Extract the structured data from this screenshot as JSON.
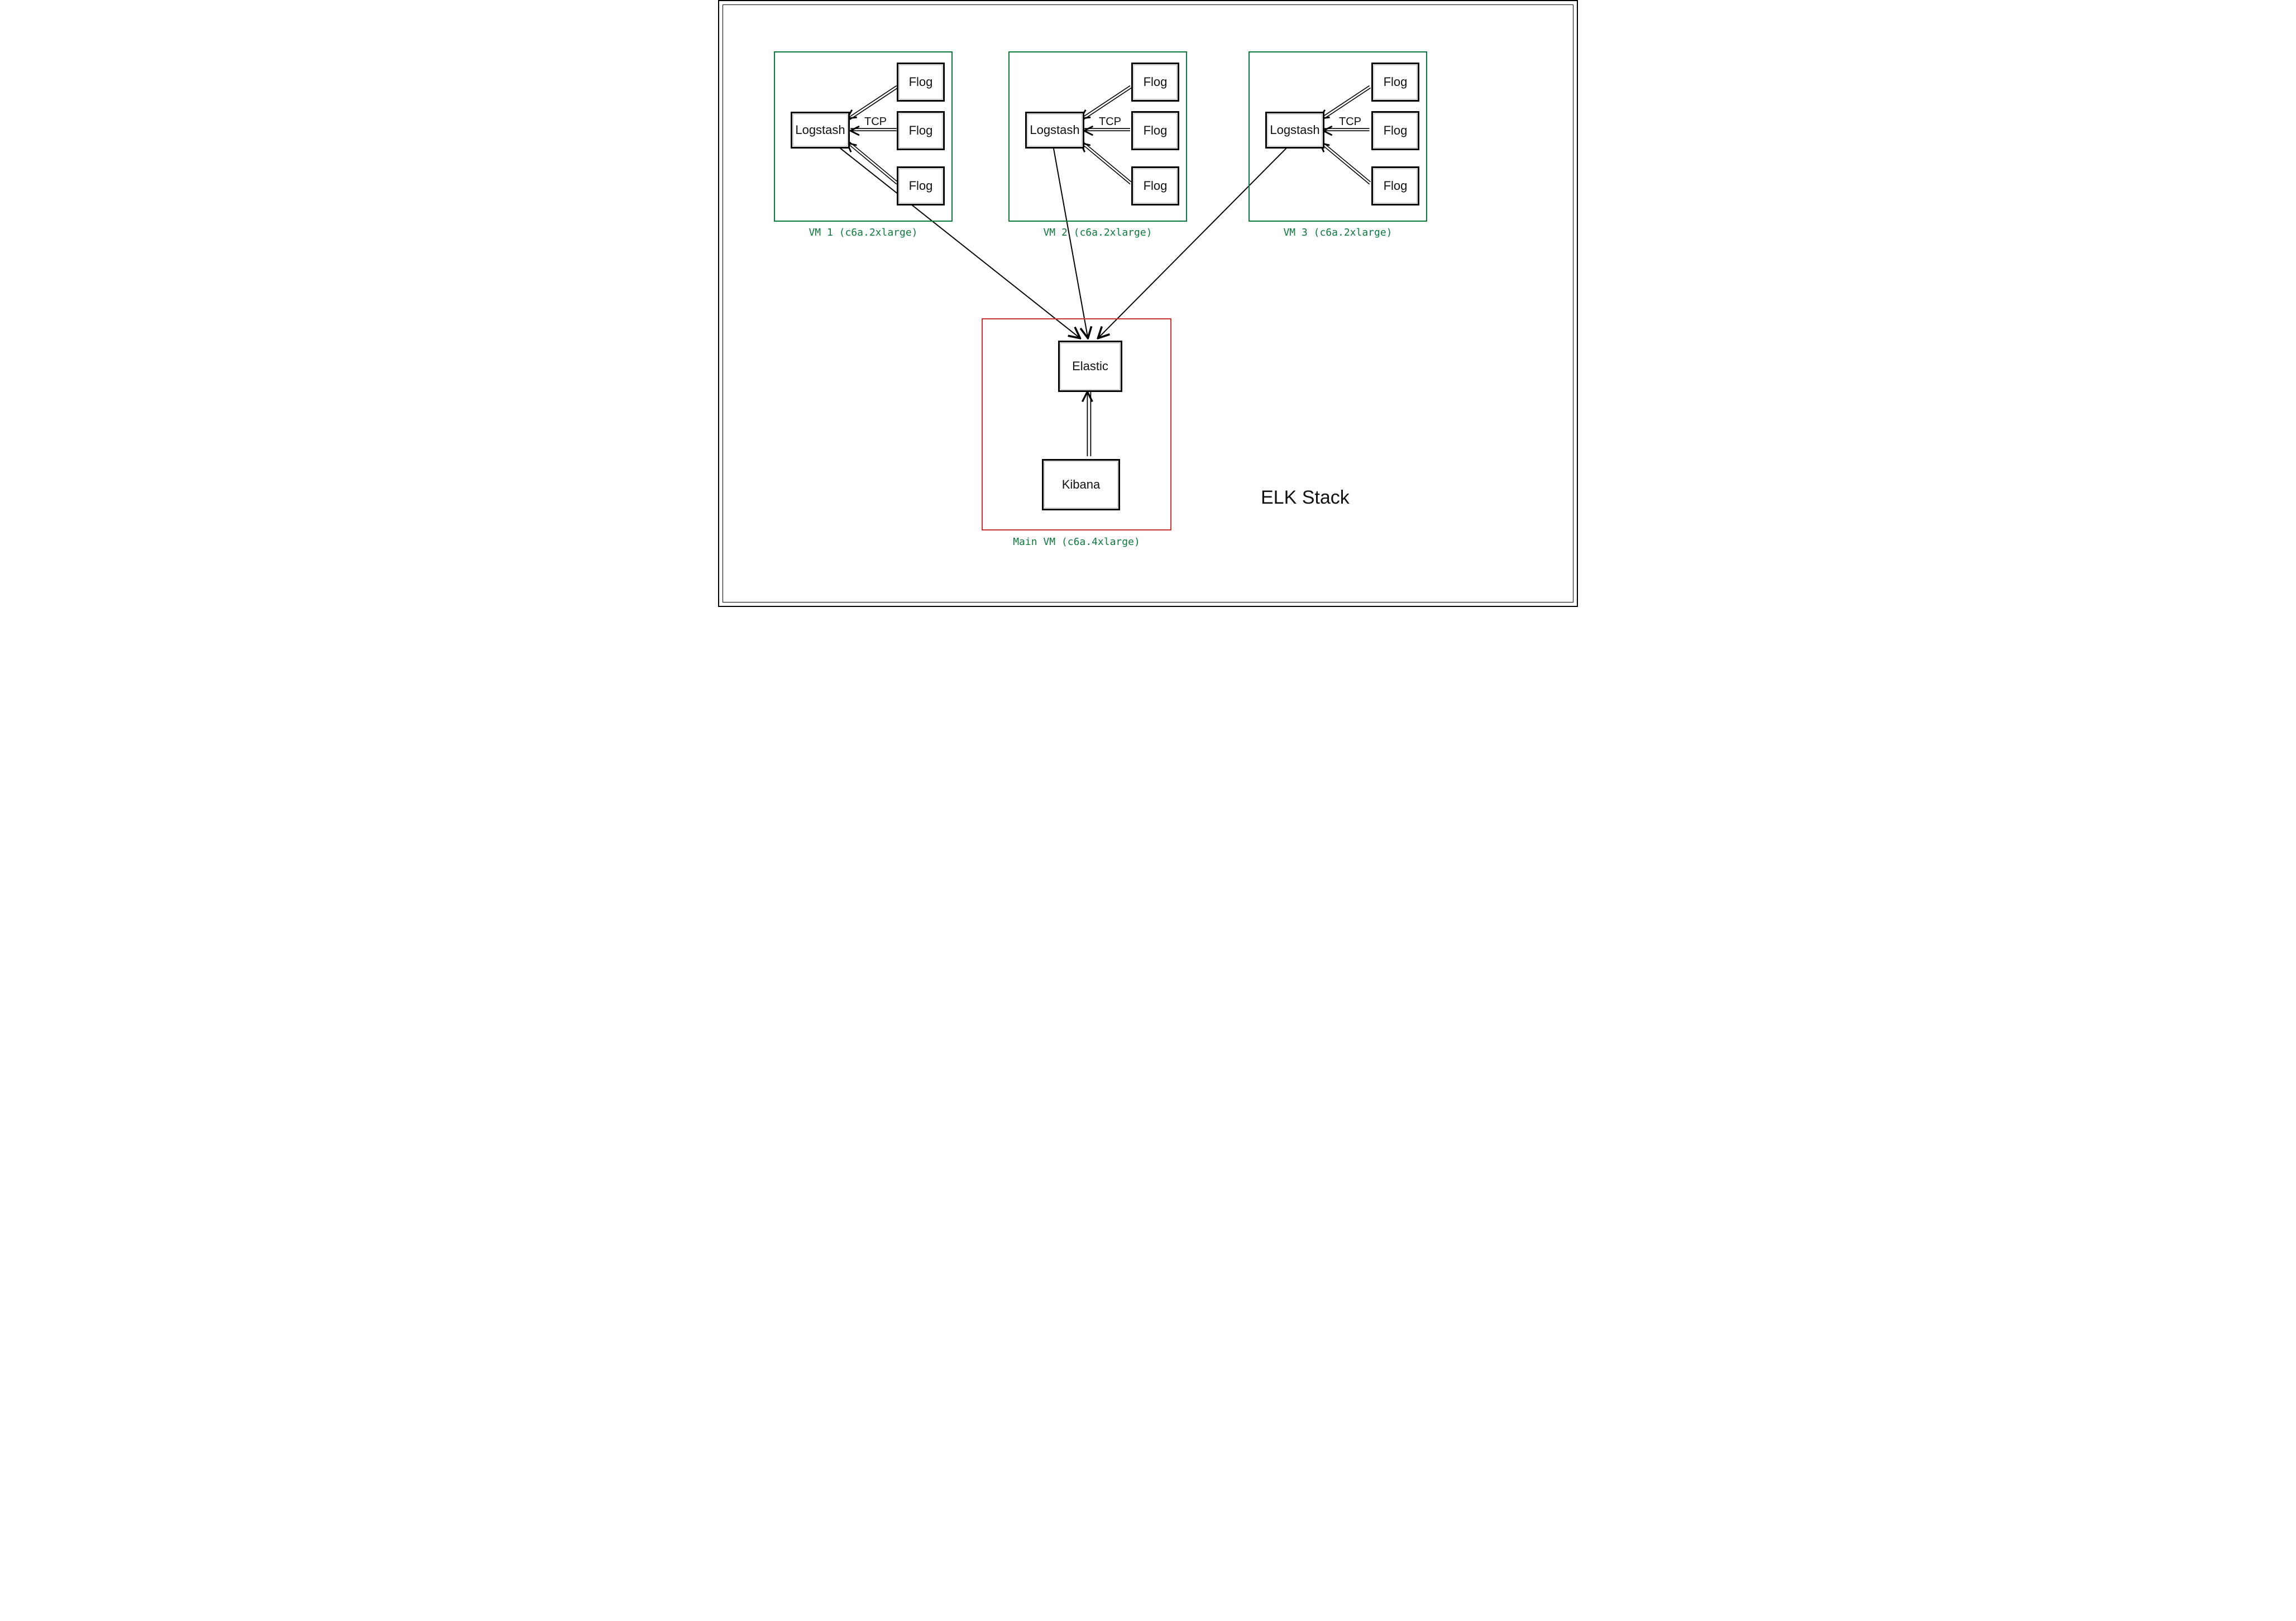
{
  "diagram": {
    "title": "ELK Stack",
    "edge_protocol": "TCP",
    "vms": [
      {
        "id": "vm1",
        "label": "VM 1 (c6a.2xlarge)"
      },
      {
        "id": "vm2",
        "label": "VM 2 (c6a.2xlarge)"
      },
      {
        "id": "vm3",
        "label": "VM 3 (c6a.2xlarge)"
      }
    ],
    "main_vm": {
      "label": "Main VM (c6a.4xlarge)"
    },
    "nodes": {
      "logstash": "Logstash",
      "flog": "Flog",
      "elastic": "Elastic",
      "kibana": "Kibana"
    }
  }
}
